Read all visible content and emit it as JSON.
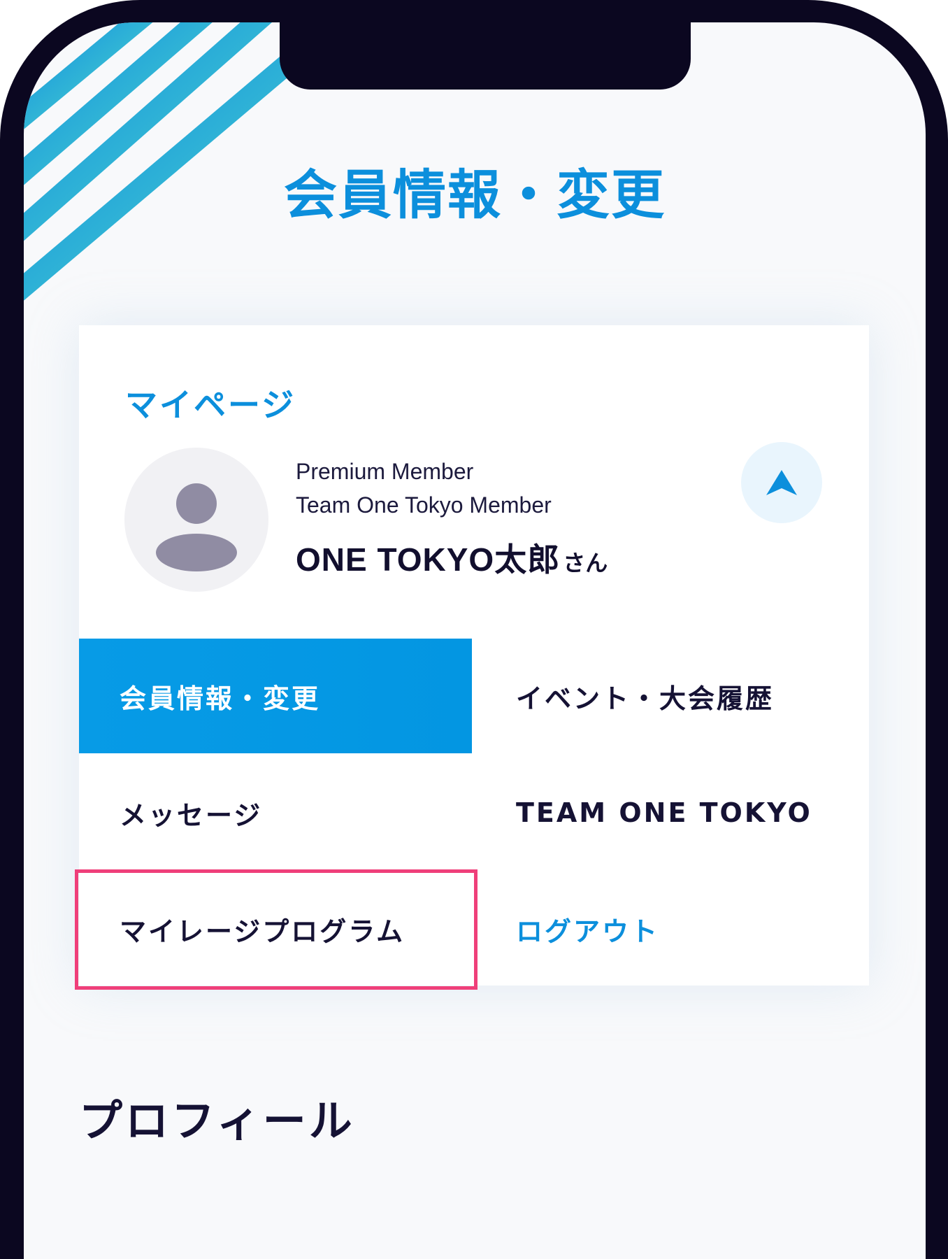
{
  "page": {
    "title": "会員情報・変更"
  },
  "mypage": {
    "label": "マイページ",
    "member_type": "Premium Member",
    "team_membership": "Team One Tokyo Member",
    "user_name": "ONE TOKYO太郎",
    "honorific": "さん",
    "collapse_icon": "chevron-up-icon"
  },
  "menu": {
    "items": [
      {
        "label": "会員情報・変更",
        "state": "active"
      },
      {
        "label": "イベント・大会履歴"
      },
      {
        "label": "メッセージ"
      },
      {
        "label": "TEAM ONE TOKYO"
      },
      {
        "label": "マイレージプログラム",
        "state": "highlighted"
      },
      {
        "label": "ログアウト",
        "style": "link"
      }
    ]
  },
  "profile_section": {
    "title": "プロフィール"
  },
  "colors": {
    "accent": "#0c8fdc",
    "active_bg": "#079be6",
    "highlight": "#ef3f7a",
    "text_dark": "#151234",
    "stripe_blue": "#1a9ae0",
    "stripe_green": "#6ee6bf"
  }
}
